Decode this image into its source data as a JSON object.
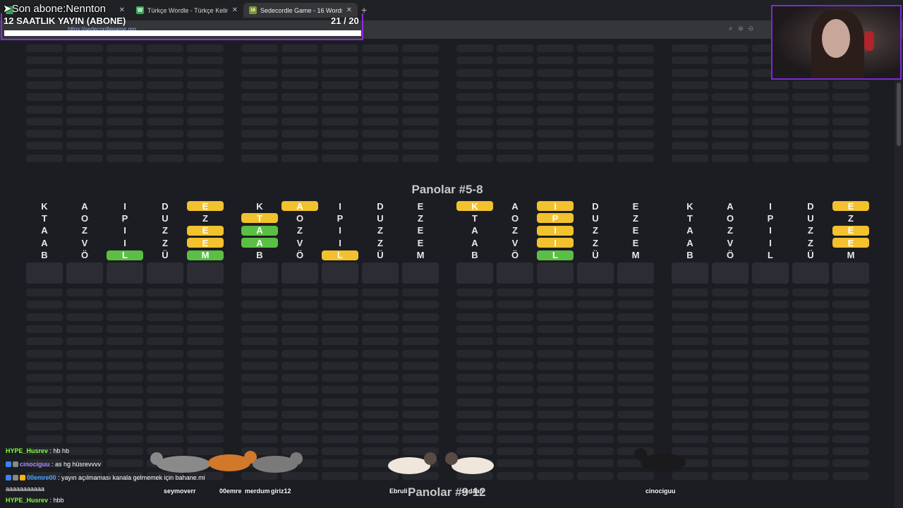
{
  "browser": {
    "tabs": [
      {
        "favicon": "W",
        "title": "Türkçe Wordle - Türkçe Kelimeleri"
      },
      {
        "favicon": "16",
        "title": "Sedecordle Game - 16 Words Wor"
      }
    ],
    "url": "https://sedecordlegame.org"
  },
  "overlay": {
    "sub_ticker": "➤Son abone:Nennton",
    "goal_title": "12 SAATLIK YAYIN (ABONE)",
    "goal_count": "21  / 20",
    "goal_progress": 1.0
  },
  "game": {
    "section_title": "Panolar #5-8",
    "next_section_title": "Panolar #9-12",
    "boards": [
      {
        "rows": [
          [
            [
              "K",
              ""
            ],
            [
              "A",
              ""
            ],
            [
              "I",
              ""
            ],
            [
              "D",
              ""
            ],
            [
              "E",
              "y"
            ]
          ],
          [
            [
              "T",
              ""
            ],
            [
              "O",
              ""
            ],
            [
              "P",
              ""
            ],
            [
              "U",
              ""
            ],
            [
              "Z",
              ""
            ]
          ],
          [
            [
              "A",
              ""
            ],
            [
              "Z",
              ""
            ],
            [
              "I",
              ""
            ],
            [
              "Z",
              ""
            ],
            [
              "E",
              "y"
            ]
          ],
          [
            [
              "A",
              ""
            ],
            [
              "V",
              ""
            ],
            [
              "I",
              ""
            ],
            [
              "Z",
              ""
            ],
            [
              "E",
              "y"
            ]
          ],
          [
            [
              "B",
              ""
            ],
            [
              "Ö",
              ""
            ],
            [
              "L",
              "g"
            ],
            [
              "Ü",
              ""
            ],
            [
              "M",
              "g"
            ]
          ]
        ]
      },
      {
        "rows": [
          [
            [
              "K",
              ""
            ],
            [
              "A",
              "y"
            ],
            [
              "I",
              ""
            ],
            [
              "D",
              ""
            ],
            [
              "E",
              ""
            ]
          ],
          [
            [
              "T",
              "y"
            ],
            [
              "O",
              ""
            ],
            [
              "P",
              ""
            ],
            [
              "U",
              ""
            ],
            [
              "Z",
              ""
            ]
          ],
          [
            [
              "A",
              "g"
            ],
            [
              "Z",
              ""
            ],
            [
              "I",
              ""
            ],
            [
              "Z",
              ""
            ],
            [
              "E",
              ""
            ]
          ],
          [
            [
              "A",
              "g"
            ],
            [
              "V",
              ""
            ],
            [
              "I",
              ""
            ],
            [
              "Z",
              ""
            ],
            [
              "E",
              ""
            ]
          ],
          [
            [
              "B",
              ""
            ],
            [
              "Ö",
              ""
            ],
            [
              "L",
              "y"
            ],
            [
              "Ü",
              ""
            ],
            [
              "M",
              ""
            ]
          ]
        ]
      },
      {
        "rows": [
          [
            [
              "K",
              "y"
            ],
            [
              "A",
              ""
            ],
            [
              "I",
              "y"
            ],
            [
              "D",
              ""
            ],
            [
              "E",
              ""
            ]
          ],
          [
            [
              "T",
              ""
            ],
            [
              "O",
              ""
            ],
            [
              "P",
              "y"
            ],
            [
              "U",
              ""
            ],
            [
              "Z",
              ""
            ]
          ],
          [
            [
              "A",
              ""
            ],
            [
              "Z",
              ""
            ],
            [
              "I",
              "y"
            ],
            [
              "Z",
              ""
            ],
            [
              "E",
              ""
            ]
          ],
          [
            [
              "A",
              ""
            ],
            [
              "V",
              ""
            ],
            [
              "I",
              "y"
            ],
            [
              "Z",
              ""
            ],
            [
              "E",
              ""
            ]
          ],
          [
            [
              "B",
              ""
            ],
            [
              "Ö",
              ""
            ],
            [
              "L",
              "g"
            ],
            [
              "Ü",
              ""
            ],
            [
              "M",
              ""
            ]
          ]
        ]
      },
      {
        "rows": [
          [
            [
              "K",
              ""
            ],
            [
              "A",
              ""
            ],
            [
              "I",
              ""
            ],
            [
              "D",
              ""
            ],
            [
              "E",
              "y"
            ]
          ],
          [
            [
              "T",
              ""
            ],
            [
              "O",
              ""
            ],
            [
              "P",
              ""
            ],
            [
              "U",
              ""
            ],
            [
              "Z",
              ""
            ]
          ],
          [
            [
              "A",
              ""
            ],
            [
              "Z",
              ""
            ],
            [
              "I",
              ""
            ],
            [
              "Z",
              ""
            ],
            [
              "E",
              "y"
            ]
          ],
          [
            [
              "A",
              ""
            ],
            [
              "V",
              ""
            ],
            [
              "I",
              ""
            ],
            [
              "Z",
              ""
            ],
            [
              "E",
              "y"
            ]
          ],
          [
            [
              "B",
              ""
            ],
            [
              "Ö",
              ""
            ],
            [
              "L",
              ""
            ],
            [
              "Ü",
              ""
            ],
            [
              "M",
              ""
            ]
          ]
        ]
      }
    ]
  },
  "chat": [
    {
      "user": "HYPE_Husrev",
      "color": "#7fff3a",
      "message": " : hb hb",
      "badges": []
    },
    {
      "user": "cinociguu",
      "color": "#a78bfa",
      "message": " : as hg hüsrevvvv",
      "badges": [
        "#3b82f6",
        "#888888"
      ]
    },
    {
      "user": "00emre00",
      "color": "#4aa3ff",
      "message": " : yayın açılmaması kanala gelmemek için bahane.mi",
      "badges": [
        "#3b82f6",
        "#888888",
        "#f5b50a"
      ]
    },
    {
      "user": "",
      "color": "#ffffff",
      "message": "aaaaaaaaaaa",
      "badges": []
    },
    {
      "user": "HYPE_Husrev",
      "color": "#7fff3a",
      "message": " : hbb",
      "badges": []
    }
  ],
  "cat_labels": [
    "seymoverr",
    "00emre",
    "merdum",
    "giriz12",
    "Ebruli",
    "sedaan",
    "cinociguu"
  ],
  "colors": {
    "yellow": "#f2c12e",
    "green": "#5bbf45",
    "accent": "#8a2be2"
  }
}
